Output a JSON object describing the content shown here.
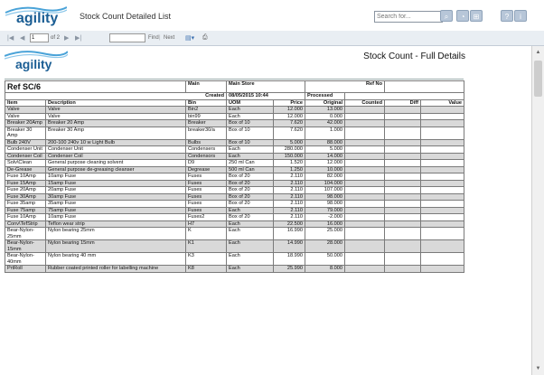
{
  "header": {
    "logo_text": "agility",
    "title": "Stock Count Detailed List",
    "search_placeholder": "Search for...",
    "buttons": [
      {
        "name": "search-button",
        "glyph": "⌕"
      },
      {
        "name": "rss-button",
        "glyph": "))"
      },
      {
        "name": "network-button",
        "glyph": "⊞"
      },
      {
        "name": "help-button",
        "glyph": "?"
      },
      {
        "name": "info-button",
        "glyph": "i"
      }
    ]
  },
  "toolbar": {
    "page_value": "1",
    "page_of": "of 2",
    "find_label": "Find",
    "separator": "|",
    "next_label": "Next"
  },
  "report": {
    "logo_text": "agility",
    "title": "Stock Count - Full Details",
    "ref_label": "Ref SC/6",
    "main_label": "Main",
    "main_store": "Main Store",
    "refno_label": "Ref No",
    "created_label": "Created",
    "created_value": "08/05/2015 10:44",
    "processed_label": "Processed",
    "columns": [
      "Item",
      "Description",
      "Bin",
      "UOM",
      "Price",
      "Original",
      "Counted",
      "Diff",
      "Value"
    ],
    "rows": [
      {
        "item": "Valve",
        "desc": "Valve",
        "bin": "Bin2",
        "uom": "Each",
        "price": "12.000",
        "original": "13.000"
      },
      {
        "item": "Valve",
        "desc": "Valve",
        "bin": "bin99",
        "uom": "Each",
        "price": "12.000",
        "original": "0.000"
      },
      {
        "item": "Breaker 20Amp",
        "desc": "Breaker 20 Amp",
        "bin": "Breaker",
        "uom": "Box of 10",
        "price": "7.620",
        "original": "42.000"
      },
      {
        "item": "Breaker 30 Amp",
        "desc": "Breaker 30 Amp",
        "bin": "breaker30/a",
        "uom": "Box of 10",
        "price": "7.620",
        "original": "1.000"
      },
      {
        "item": "Bulb 240V",
        "desc": "200-100 240v 10 w Light Bulb",
        "bin": "Bulbs",
        "uom": "Box of 10",
        "price": "5.000",
        "original": "88.000"
      },
      {
        "item": "Condenser Unit",
        "desc": "Condenser Unit",
        "bin": "Condensers",
        "uom": "Each",
        "price": "280.000",
        "original": "5.000"
      },
      {
        "item": "Condenser Coil",
        "desc": "Condenser Coil",
        "bin": "Condensors",
        "uom": "Each",
        "price": "150.000",
        "original": "14.000"
      },
      {
        "item": "Solv\\Clean",
        "desc": "General purpose cleaning solvent",
        "bin": "D9",
        "uom": "250 ml Can",
        "price": "1.520",
        "original": "12.000"
      },
      {
        "item": "De-Grease",
        "desc": "General purpose de-greasing cleanser",
        "bin": "Degrease",
        "uom": "500 ml Can",
        "price": "1.250",
        "original": "10.000"
      },
      {
        "item": "Fuse 10Amp",
        "desc": "10amp Fuse",
        "bin": "Fuses",
        "uom": "Box of 20",
        "price": "2.110",
        "original": "82.000"
      },
      {
        "item": "Fuse 15Amp",
        "desc": "15amp Fuse",
        "bin": "Fuses",
        "uom": "Box of 20",
        "price": "2.110",
        "original": "104.000"
      },
      {
        "item": "Fuse 20Amp",
        "desc": "20amp Fuse",
        "bin": "Fuses",
        "uom": "Box of 20",
        "price": "2.110",
        "original": "107.000"
      },
      {
        "item": "Fuse 30Amp",
        "desc": "30amp Fuse",
        "bin": "Fuses",
        "uom": "Box of 20",
        "price": "2.110",
        "original": "98.000"
      },
      {
        "item": "Fuse 35amp",
        "desc": "35amp Fuse",
        "bin": "Fuses",
        "uom": "Box of 20",
        "price": "2.110",
        "original": "98.000"
      },
      {
        "item": "Fuse 75amp",
        "desc": "75amp Fuse",
        "bin": "Fuses",
        "uom": "Each",
        "price": "2.110",
        "original": "79.000"
      },
      {
        "item": "Fuse 10Amp",
        "desc": "10amp Fuse",
        "bin": "Fuses2",
        "uom": "Box of 20",
        "price": "2.110",
        "original": "-2.000"
      },
      {
        "item": "Conv\\TefStrip",
        "desc": "Teflon wear strip",
        "bin": "H7",
        "uom": "Each",
        "price": "22.500",
        "original": "16.000"
      },
      {
        "item": "Bear-Nylon-25mm",
        "desc": "Nylon bearing 25mm",
        "bin": "K",
        "uom": "Each",
        "price": "16.990",
        "original": "25.000"
      },
      {
        "item": "Bear-Nylon-15mm",
        "desc": "Nylon bearing 15mm",
        "bin": "K1",
        "uom": "Each",
        "price": "14.990",
        "original": "28.000"
      },
      {
        "item": "Bear-Nylon-40mm",
        "desc": "Nylon bearing 40 mm",
        "bin": "K3",
        "uom": "Each",
        "price": "18.990",
        "original": "50.000"
      },
      {
        "item": "PrtRoll",
        "desc": "Rubber coated printed roller for labelling machine",
        "bin": "K8",
        "uom": "Each",
        "price": "25.990",
        "original": "8.000"
      }
    ]
  }
}
